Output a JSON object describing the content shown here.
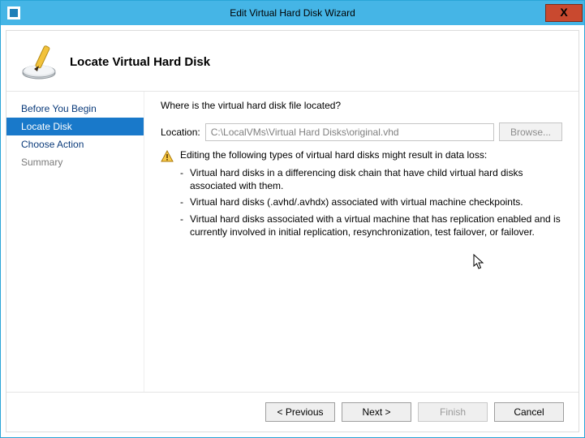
{
  "window": {
    "title": "Edit Virtual Hard Disk Wizard",
    "close_label": "X"
  },
  "header": {
    "title": "Locate Virtual Hard Disk"
  },
  "sidebar": {
    "steps": [
      {
        "label": "Before You Begin",
        "state": ""
      },
      {
        "label": "Locate Disk",
        "state": "active"
      },
      {
        "label": "Choose Action",
        "state": ""
      },
      {
        "label": "Summary",
        "state": "dim"
      }
    ]
  },
  "content": {
    "question": "Where is the virtual hard disk file located?",
    "location_label": "Location:",
    "location_value": "C:\\LocalVMs\\Virtual Hard Disks\\original.vhd",
    "browse_label": "Browse...",
    "warning_intro": "Editing the following types of virtual hard disks might result in data loss:",
    "warnings": [
      "Virtual hard disks in a differencing disk chain that have child virtual hard disks associated with them.",
      "Virtual hard disks (.avhd/.avhdx) associated with virtual machine checkpoints.",
      "Virtual hard disks associated with a virtual machine that has replication enabled and is currently involved in initial replication, resynchronization, test failover, or failover."
    ]
  },
  "footer": {
    "previous": "< Previous",
    "next": "Next >",
    "finish": "Finish",
    "cancel": "Cancel"
  }
}
